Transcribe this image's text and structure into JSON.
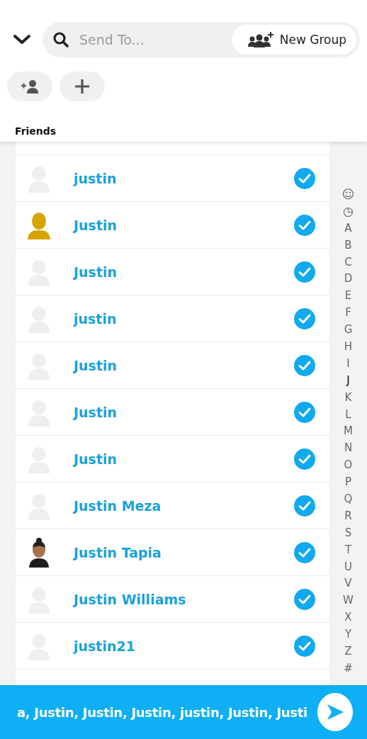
{
  "search": {
    "placeholder": "Send To..."
  },
  "new_group_button": {
    "label": "New Group"
  },
  "section_title": "Friends",
  "friends": [
    {
      "name": "justin",
      "kind": "blank",
      "selected": true
    },
    {
      "name": "Justin",
      "kind": "silhouette",
      "selected": true
    },
    {
      "name": "Justin",
      "kind": "blank",
      "selected": true
    },
    {
      "name": "justin",
      "kind": "blank",
      "selected": true
    },
    {
      "name": "Justin",
      "kind": "blank",
      "selected": true
    },
    {
      "name": "Justin",
      "kind": "blank",
      "selected": true
    },
    {
      "name": "Justin",
      "kind": "blank",
      "selected": true
    },
    {
      "name": "Justin Meza",
      "kind": "blank",
      "selected": true
    },
    {
      "name": "Justin Tapia",
      "kind": "figure",
      "selected": true
    },
    {
      "name": "Justin Williams",
      "kind": "blank",
      "selected": true
    },
    {
      "name": "justin21",
      "kind": "blank",
      "selected": true
    }
  ],
  "index": [
    {
      "label": "☺",
      "kind": "icon",
      "selected": false
    },
    {
      "label": "◷",
      "kind": "icon",
      "selected": false
    },
    {
      "label": "A",
      "kind": "letter",
      "selected": false
    },
    {
      "label": "B",
      "kind": "letter",
      "selected": false
    },
    {
      "label": "C",
      "kind": "letter",
      "selected": false
    },
    {
      "label": "D",
      "kind": "letter",
      "selected": false
    },
    {
      "label": "E",
      "kind": "letter",
      "selected": false
    },
    {
      "label": "F",
      "kind": "letter",
      "selected": false
    },
    {
      "label": "G",
      "kind": "letter",
      "selected": false
    },
    {
      "label": "H",
      "kind": "letter",
      "selected": false
    },
    {
      "label": "I",
      "kind": "letter",
      "selected": false
    },
    {
      "label": "J",
      "kind": "letter",
      "selected": true
    },
    {
      "label": "K",
      "kind": "letter",
      "selected": false
    },
    {
      "label": "L",
      "kind": "letter",
      "selected": false
    },
    {
      "label": "M",
      "kind": "letter",
      "selected": false
    },
    {
      "label": "N",
      "kind": "letter",
      "selected": false
    },
    {
      "label": "O",
      "kind": "letter",
      "selected": false
    },
    {
      "label": "P",
      "kind": "letter",
      "selected": false
    },
    {
      "label": "Q",
      "kind": "letter",
      "selected": false
    },
    {
      "label": "R",
      "kind": "letter",
      "selected": false
    },
    {
      "label": "S",
      "kind": "letter",
      "selected": false
    },
    {
      "label": "T",
      "kind": "letter",
      "selected": false
    },
    {
      "label": "U",
      "kind": "letter",
      "selected": false
    },
    {
      "label": "V",
      "kind": "letter",
      "selected": false
    },
    {
      "label": "W",
      "kind": "letter",
      "selected": false
    },
    {
      "label": "X",
      "kind": "letter",
      "selected": false
    },
    {
      "label": "Y",
      "kind": "letter",
      "selected": false
    },
    {
      "label": "Z",
      "kind": "letter",
      "selected": false
    },
    {
      "label": "#",
      "kind": "letter",
      "selected": false
    }
  ],
  "send_bar": {
    "recipients": "a, Justin, Justin, Justin, justin, Justin, Justi"
  }
}
